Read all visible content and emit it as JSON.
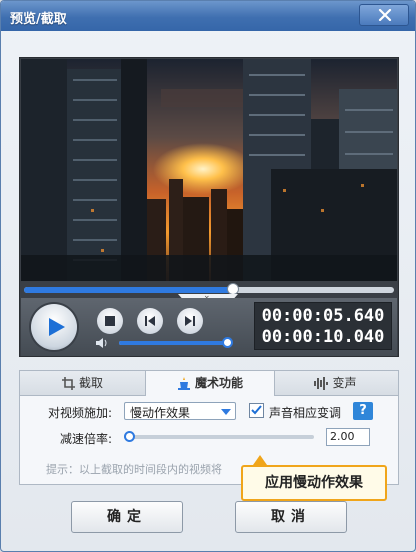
{
  "window": {
    "title": "预览/截取"
  },
  "player": {
    "progress_fraction": 0.565,
    "volume_fraction": 1.0,
    "current_time": "00:00:05.640",
    "total_time": "00:00:10.040"
  },
  "tabs": [
    {
      "label": "截取",
      "icon": "crop-icon"
    },
    {
      "label": "魔术功能",
      "icon": "magic-hat-icon",
      "active": true
    },
    {
      "label": "变声",
      "icon": "waveform-icon"
    }
  ],
  "magic": {
    "apply_label": "对视频施加:",
    "effect_value": "慢动作效果",
    "pitch_checkbox_label": "声音相应变调",
    "pitch_checked": true,
    "help_label": "?",
    "speed_label": "减速倍率:",
    "speed_value": "2.00",
    "hint": "提示：以上截取的时间段内的视频将"
  },
  "tooltip": {
    "text": "应用慢动作效果"
  },
  "buttons": {
    "ok": "确定",
    "cancel": "取消"
  },
  "colors": {
    "accent": "#2f7ae0",
    "tooltip_border": "#f0a51a",
    "titlebar": "#3f6fb0"
  }
}
